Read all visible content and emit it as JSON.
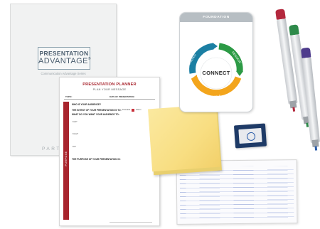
{
  "binder": {
    "title_top": "PRESENTATION",
    "title_bottom": "ADVANTAGE",
    "registered": "®",
    "subtitle": "Communication Advantage Series",
    "footer": "PARTIC"
  },
  "planner": {
    "title": "PRESENTATION PLANNER",
    "subtitle": "PLAN YOUR MESSAGE",
    "top_left": "TOPIC:",
    "top_right": "DATE OF PRESENTATION:",
    "q_audience": "WHO IS YOUR AUDIENCE?",
    "q_intent": "THE INTENT OF YOUR PRESENTATION IS TO:",
    "intent_opt_1": "Persuade",
    "intent_opt_2": "Inform",
    "q_want": "WHAT DO YOU WANT YOUR AUDIENCE TO:",
    "want_1": "Feel?",
    "want_2": "Know?",
    "want_3": "Do?",
    "q_purpose": "THE PURPOSE OF YOUR PRESENTATION IS:",
    "side_label": "PURPOSE"
  },
  "card": {
    "header": "FOUNDATION",
    "center": "CONNECT",
    "seg_left": "AUDIENCE",
    "seg_right": "MESSAGE",
    "seg_bottom": "YOURSELF",
    "colors": {
      "teal": "#1b7fa3",
      "green": "#2c9a45",
      "orange": "#f3a51c"
    }
  },
  "pens": {
    "colors": [
      "#b3283d",
      "#2e8a4a",
      "#4e3c8c",
      "#2a5ca8"
    ]
  }
}
